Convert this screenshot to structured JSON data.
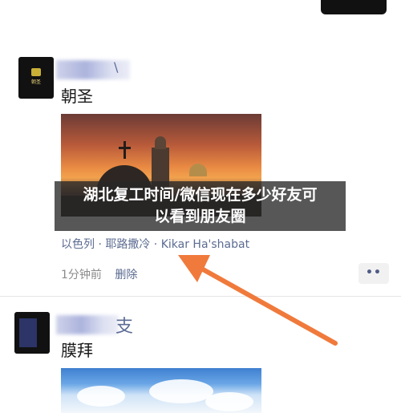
{
  "headline": {
    "line1": "湖北复工时间/微信现在多少好友可",
    "line2": "以看到朋友圈"
  },
  "posts": [
    {
      "avatar_text": "朝圣",
      "text": "朝圣",
      "location": "以色列 · 耶路撒冷 · Kikar Ha'shabat",
      "time": "1分钟前",
      "delete_label": "删除",
      "more_label": "••",
      "name_tail": "\\"
    },
    {
      "text": "膜拜",
      "name_tail": "支"
    }
  ],
  "colors": {
    "link": "#5b6b91",
    "arrow": "#f07a3c",
    "banner": "#282828"
  },
  "icons": [
    "more-icon",
    "pointer-arrow-icon"
  ]
}
